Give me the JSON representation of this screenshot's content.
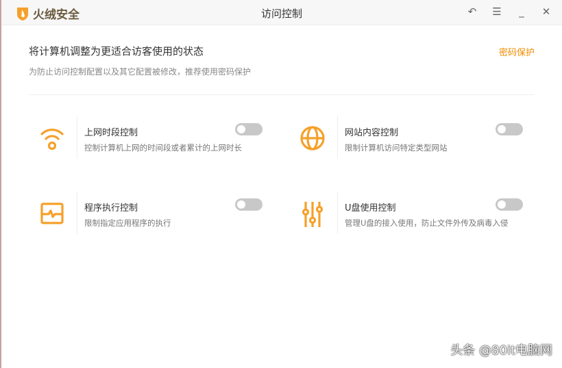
{
  "app": {
    "brand": "火绒安全",
    "window_title": "访问控制"
  },
  "header": {
    "title": "将计算机调整为更适合访客使用的状态",
    "subtitle": "为防止访问控制配置以及其它配置被修改，推荐使用密码保护",
    "password_link": "密码保护"
  },
  "controls": [
    {
      "title": "上网时段控制",
      "desc": "控制计算机上网的时间段或者累计的上网时长",
      "icon": "wifi-icon",
      "enabled": false
    },
    {
      "title": "网站内容控制",
      "desc": "限制计算机访问特定类型网站",
      "icon": "globe-icon",
      "enabled": false
    },
    {
      "title": "程序执行控制",
      "desc": "限制指定应用程序的执行",
      "icon": "monitor-pulse-icon",
      "enabled": false
    },
    {
      "title": "U盘使用控制",
      "desc": "管理U盘的接入使用，防止文件外传及病毒入侵",
      "icon": "sliders-icon",
      "enabled": false
    }
  ],
  "watermark": "头条 @80it电脑网",
  "colors": {
    "accent": "#f5a02a",
    "link": "#f08c00",
    "toggle_off": "#c8c8c8"
  }
}
